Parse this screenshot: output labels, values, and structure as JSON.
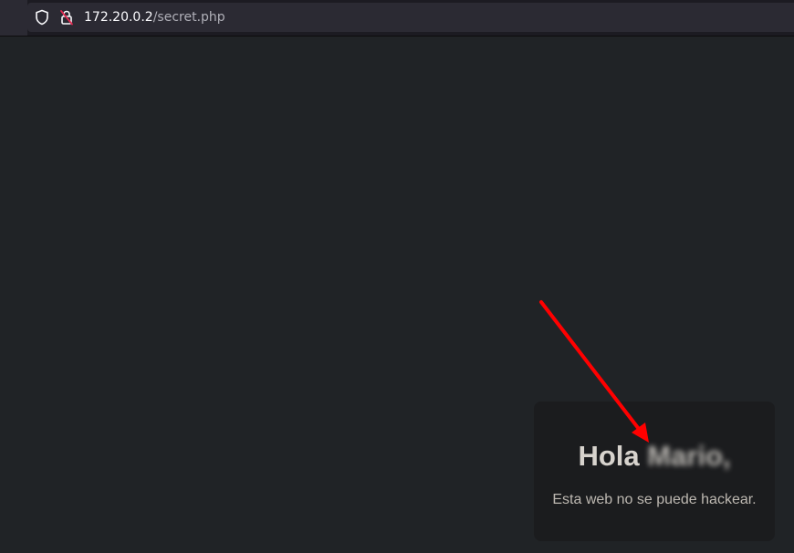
{
  "address_bar": {
    "host": "172.20.0.2",
    "path": "/secret.php",
    "icons": [
      "shield-icon",
      "insecure-lock-icon"
    ]
  },
  "page": {
    "greeting": "Hola",
    "name": "Mario,",
    "subtitle": "Esta web no se puede hackear."
  },
  "annotation": {
    "type": "red-arrow",
    "color": "#ff0000"
  },
  "colors": {
    "background": "#202326",
    "card": "#1b1c1e",
    "text": "#d7d3cd"
  }
}
